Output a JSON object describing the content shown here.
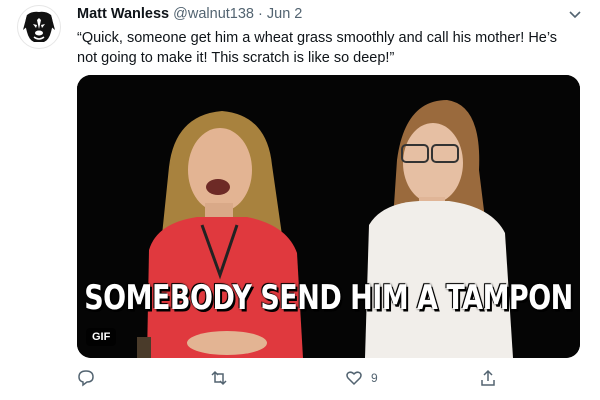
{
  "tweet": {
    "author_name": "Matt Wanless",
    "handle": "@walnut138",
    "separator": "·",
    "date": "Jun 2",
    "text": "“Quick, someone get him a wheat grass smoothly and call his mother! He’s not going to make it! This scratch is like so deep!”"
  },
  "media": {
    "caption": "SOMEBODY SEND HIM A TAMPON",
    "badge": "GIF"
  },
  "actions": {
    "reply_count": "",
    "retweet_count": "",
    "like_count": "9"
  },
  "colors": {
    "text_secondary": "#536471",
    "icon_gray": "#536471",
    "media_background": "#050505"
  },
  "icons": [
    "dog-avatar-icon",
    "chevron-down-icon",
    "reply-icon",
    "retweet-icon",
    "like-icon",
    "share-icon"
  ]
}
